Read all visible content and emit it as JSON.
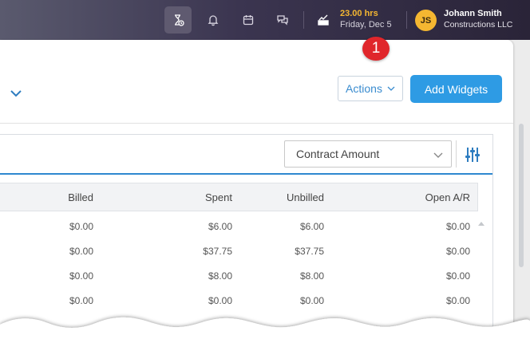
{
  "topbar": {
    "icons": [
      "timer-icon",
      "bell-icon",
      "calendar-icon",
      "chat-icon",
      "timecard-icon"
    ],
    "hours": "23.00 hrs",
    "date": "Friday, Dec 5",
    "user": {
      "initials": "JS",
      "name": "Johann Smith",
      "company": "Constructions LLC"
    },
    "badge_number": "1"
  },
  "toolbar": {
    "actions_label": "Actions",
    "add_widgets_label": "Add Widgets"
  },
  "widget": {
    "select_value": "Contract Amount",
    "columns": [
      "Billed",
      "Spent",
      "Unbilled",
      "Open A/R"
    ],
    "rows": [
      [
        "$0.00",
        "$6.00",
        "$6.00",
        "$0.00"
      ],
      [
        "$0.00",
        "$37.75",
        "$37.75",
        "$0.00"
      ],
      [
        "$0.00",
        "$8.00",
        "$8.00",
        "$0.00"
      ],
      [
        "$0.00",
        "$0.00",
        "$0.00",
        "$0.00"
      ]
    ]
  },
  "colors": {
    "accent_blue": "#2e9be4",
    "hours_gold": "#f5b731",
    "badge_red": "#e0262b"
  }
}
